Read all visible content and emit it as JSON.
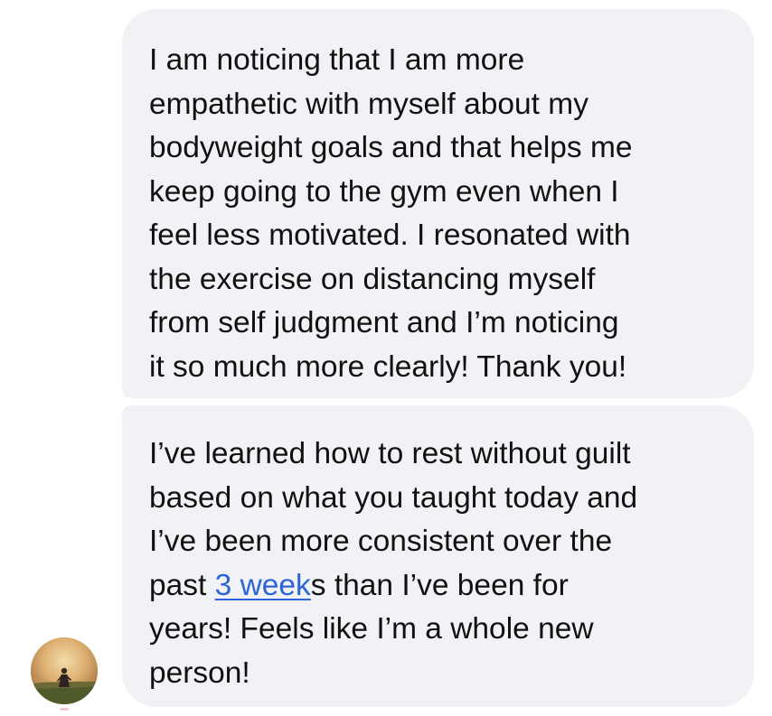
{
  "messages": [
    {
      "lines": [
        "I am noticing that I am more",
        "empathetic with myself about my",
        "bodyweight goals and that helps me",
        "keep going to the gym even when I",
        "feel less motivated. I resonated with",
        "the exercise on distancing myself",
        "from self judgment and I’m noticing",
        "it so much more clearly! Thank you!"
      ]
    },
    {
      "lines": [
        "I’ve learned how to rest without guilt",
        "based on what you taught today and",
        "I’ve been more consistent over the"
      ],
      "link_line": {
        "before": "past ",
        "link": "3 week",
        "after": "s than I’ve been for"
      },
      "lines_after": [
        "years! Feels like I’m a whole new",
        "person!"
      ]
    }
  ],
  "avatar": {
    "icon": "person-in-field-photo"
  },
  "colors": {
    "bubble_background": "#f1f2f5",
    "text": "#111111",
    "link": "#2d64d8"
  }
}
